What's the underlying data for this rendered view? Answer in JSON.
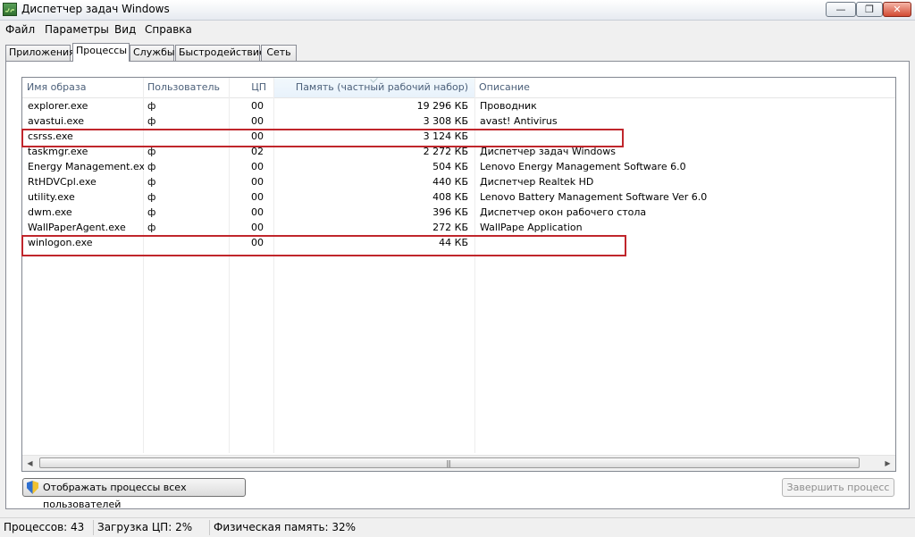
{
  "window": {
    "title": "Диспетчер задач Windows",
    "min": "—",
    "max": "❐",
    "close": "✕"
  },
  "menu": [
    "Файл",
    "Параметры",
    "Вид",
    "Справка"
  ],
  "tabs": [
    "Приложения",
    "Процессы",
    "Службы",
    "Быстродействие",
    "Сеть"
  ],
  "active_tab": "Процессы",
  "columns": [
    "Имя образа",
    "Пользователь",
    "ЦП",
    "Память (частный рабочий набор)",
    "Описание"
  ],
  "processes": [
    {
      "name": "explorer.exe",
      "user": "ф",
      "cpu": "00",
      "memory": "19 296 КБ",
      "description": "Проводник"
    },
    {
      "name": "avastui.exe",
      "user": "ф",
      "cpu": "00",
      "memory": "3 308 КБ",
      "description": "avast! Antivirus"
    },
    {
      "name": "csrss.exe",
      "user": "",
      "cpu": "00",
      "memory": "3 124 КБ",
      "description": ""
    },
    {
      "name": "taskmgr.exe",
      "user": "ф",
      "cpu": "02",
      "memory": "2 272 КБ",
      "description": "Диспетчер задач Windows"
    },
    {
      "name": "Energy Management.exe",
      "user": "ф",
      "cpu": "00",
      "memory": "504 КБ",
      "description": "Lenovo Energy Management Software 6.0"
    },
    {
      "name": "RtHDVCpl.exe",
      "user": "ф",
      "cpu": "00",
      "memory": "440 КБ",
      "description": "Диспетчер Realtek HD"
    },
    {
      "name": "utility.exe",
      "user": "ф",
      "cpu": "00",
      "memory": "408 КБ",
      "description": "Lenovo Battery Management Software Ver 6.0"
    },
    {
      "name": "dwm.exe",
      "user": "ф",
      "cpu": "00",
      "memory": "396 КБ",
      "description": "Диспетчер окон рабочего стола"
    },
    {
      "name": "WallPaperAgent.exe",
      "user": "ф",
      "cpu": "00",
      "memory": "272 КБ",
      "description": "WallPape Application"
    },
    {
      "name": "winlogon.exe",
      "user": "",
      "cpu": "00",
      "memory": "44 КБ",
      "description": ""
    }
  ],
  "buttons": {
    "show_all": "Отображать процессы всех пользователей",
    "end_process": "Завершить процесс"
  },
  "status": {
    "processes": "Процессов: 43",
    "cpu": "Загрузка ЦП: 2%",
    "memory": "Физическая память: 32%"
  },
  "highlight_color": "#c0262c",
  "icons": {
    "app": "task-manager-icon",
    "shield": "uac-shield-icon"
  }
}
